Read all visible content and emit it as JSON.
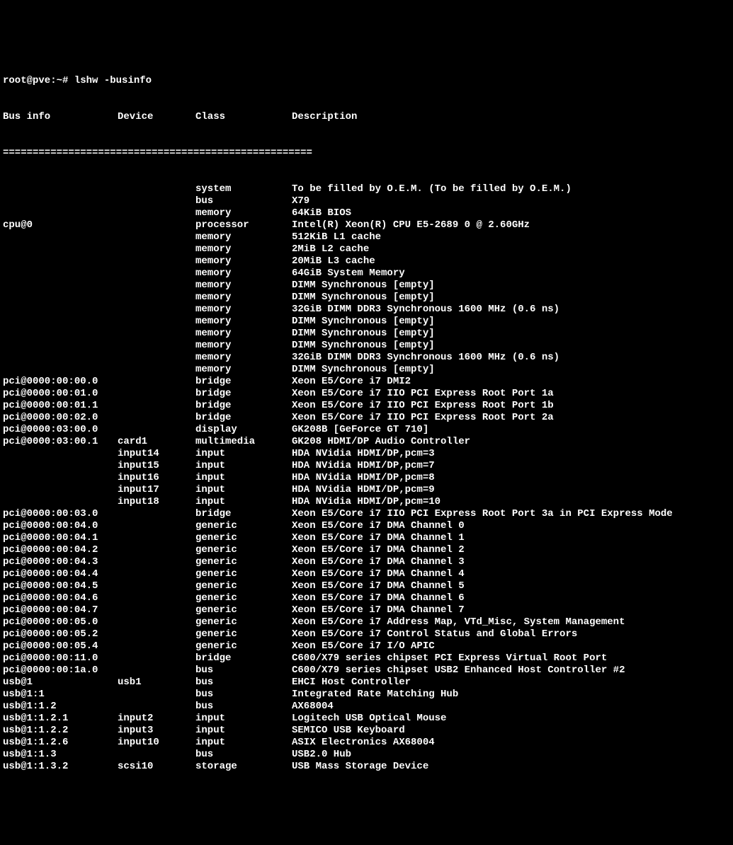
{
  "prompt": "root@pve:~# ",
  "command": "lshw -businfo",
  "header": {
    "bus": "Bus info",
    "device": "Device",
    "class": "Class",
    "description": "Description"
  },
  "separator": "====================================================",
  "rows": [
    {
      "bus": "",
      "dev": "",
      "class": "system",
      "desc": "To be filled by O.E.M. (To be filled by O.E.M.)"
    },
    {
      "bus": "",
      "dev": "",
      "class": "bus",
      "desc": "X79"
    },
    {
      "bus": "",
      "dev": "",
      "class": "memory",
      "desc": "64KiB BIOS"
    },
    {
      "bus": "cpu@0",
      "dev": "",
      "class": "processor",
      "desc": "Intel(R) Xeon(R) CPU E5-2689 0 @ 2.60GHz"
    },
    {
      "bus": "",
      "dev": "",
      "class": "memory",
      "desc": "512KiB L1 cache"
    },
    {
      "bus": "",
      "dev": "",
      "class": "memory",
      "desc": "2MiB L2 cache"
    },
    {
      "bus": "",
      "dev": "",
      "class": "memory",
      "desc": "20MiB L3 cache"
    },
    {
      "bus": "",
      "dev": "",
      "class": "memory",
      "desc": "64GiB System Memory"
    },
    {
      "bus": "",
      "dev": "",
      "class": "memory",
      "desc": "DIMM Synchronous [empty]"
    },
    {
      "bus": "",
      "dev": "",
      "class": "memory",
      "desc": "DIMM Synchronous [empty]"
    },
    {
      "bus": "",
      "dev": "",
      "class": "memory",
      "desc": "32GiB DIMM DDR3 Synchronous 1600 MHz (0.6 ns)"
    },
    {
      "bus": "",
      "dev": "",
      "class": "memory",
      "desc": "DIMM Synchronous [empty]"
    },
    {
      "bus": "",
      "dev": "",
      "class": "memory",
      "desc": "DIMM Synchronous [empty]"
    },
    {
      "bus": "",
      "dev": "",
      "class": "memory",
      "desc": "DIMM Synchronous [empty]"
    },
    {
      "bus": "",
      "dev": "",
      "class": "memory",
      "desc": "32GiB DIMM DDR3 Synchronous 1600 MHz (0.6 ns)"
    },
    {
      "bus": "",
      "dev": "",
      "class": "memory",
      "desc": "DIMM Synchronous [empty]"
    },
    {
      "bus": "pci@0000:00:00.0",
      "dev": "",
      "class": "bridge",
      "desc": "Xeon E5/Core i7 DMI2"
    },
    {
      "bus": "pci@0000:00:01.0",
      "dev": "",
      "class": "bridge",
      "desc": "Xeon E5/Core i7 IIO PCI Express Root Port 1a"
    },
    {
      "bus": "pci@0000:00:01.1",
      "dev": "",
      "class": "bridge",
      "desc": "Xeon E5/Core i7 IIO PCI Express Root Port 1b"
    },
    {
      "bus": "pci@0000:00:02.0",
      "dev": "",
      "class": "bridge",
      "desc": "Xeon E5/Core i7 IIO PCI Express Root Port 2a"
    },
    {
      "bus": "pci@0000:03:00.0",
      "dev": "",
      "class": "display",
      "desc": "GK208B [GeForce GT 710]"
    },
    {
      "bus": "pci@0000:03:00.1",
      "dev": "card1",
      "class": "multimedia",
      "desc": "GK208 HDMI/DP Audio Controller"
    },
    {
      "bus": "",
      "dev": "input14",
      "class": "input",
      "desc": "HDA NVidia HDMI/DP,pcm=3"
    },
    {
      "bus": "",
      "dev": "input15",
      "class": "input",
      "desc": "HDA NVidia HDMI/DP,pcm=7"
    },
    {
      "bus": "",
      "dev": "input16",
      "class": "input",
      "desc": "HDA NVidia HDMI/DP,pcm=8"
    },
    {
      "bus": "",
      "dev": "input17",
      "class": "input",
      "desc": "HDA NVidia HDMI/DP,pcm=9"
    },
    {
      "bus": "",
      "dev": "input18",
      "class": "input",
      "desc": "HDA NVidia HDMI/DP,pcm=10"
    },
    {
      "bus": "pci@0000:00:03.0",
      "dev": "",
      "class": "bridge",
      "desc": "Xeon E5/Core i7 IIO PCI Express Root Port 3a in PCI Express Mode"
    },
    {
      "bus": "pci@0000:00:04.0",
      "dev": "",
      "class": "generic",
      "desc": "Xeon E5/Core i7 DMA Channel 0"
    },
    {
      "bus": "pci@0000:00:04.1",
      "dev": "",
      "class": "generic",
      "desc": "Xeon E5/Core i7 DMA Channel 1"
    },
    {
      "bus": "pci@0000:00:04.2",
      "dev": "",
      "class": "generic",
      "desc": "Xeon E5/Core i7 DMA Channel 2"
    },
    {
      "bus": "pci@0000:00:04.3",
      "dev": "",
      "class": "generic",
      "desc": "Xeon E5/Core i7 DMA Channel 3"
    },
    {
      "bus": "pci@0000:00:04.4",
      "dev": "",
      "class": "generic",
      "desc": "Xeon E5/Core i7 DMA Channel 4"
    },
    {
      "bus": "pci@0000:00:04.5",
      "dev": "",
      "class": "generic",
      "desc": "Xeon E5/Core i7 DMA Channel 5"
    },
    {
      "bus": "pci@0000:00:04.6",
      "dev": "",
      "class": "generic",
      "desc": "Xeon E5/Core i7 DMA Channel 6"
    },
    {
      "bus": "pci@0000:00:04.7",
      "dev": "",
      "class": "generic",
      "desc": "Xeon E5/Core i7 DMA Channel 7"
    },
    {
      "bus": "pci@0000:00:05.0",
      "dev": "",
      "class": "generic",
      "desc": "Xeon E5/Core i7 Address Map, VTd_Misc, System Management"
    },
    {
      "bus": "pci@0000:00:05.2",
      "dev": "",
      "class": "generic",
      "desc": "Xeon E5/Core i7 Control Status and Global Errors"
    },
    {
      "bus": "pci@0000:00:05.4",
      "dev": "",
      "class": "generic",
      "desc": "Xeon E5/Core i7 I/O APIC"
    },
    {
      "bus": "pci@0000:00:11.0",
      "dev": "",
      "class": "bridge",
      "desc": "C600/X79 series chipset PCI Express Virtual Root Port"
    },
    {
      "bus": "pci@0000:00:1a.0",
      "dev": "",
      "class": "bus",
      "desc": "C600/X79 series chipset USB2 Enhanced Host Controller #2"
    },
    {
      "bus": "usb@1",
      "dev": "usb1",
      "class": "bus",
      "desc": "EHCI Host Controller"
    },
    {
      "bus": "usb@1:1",
      "dev": "",
      "class": "bus",
      "desc": "Integrated Rate Matching Hub"
    },
    {
      "bus": "usb@1:1.2",
      "dev": "",
      "class": "bus",
      "desc": "AX68004"
    },
    {
      "bus": "usb@1:1.2.1",
      "dev": "input2",
      "class": "input",
      "desc": "Logitech USB Optical Mouse"
    },
    {
      "bus": "usb@1:1.2.2",
      "dev": "input3",
      "class": "input",
      "desc": "SEMICO USB Keyboard"
    },
    {
      "bus": "usb@1:1.2.6",
      "dev": "input10",
      "class": "input",
      "desc": "ASIX Electronics AX68004"
    },
    {
      "bus": "usb@1:1.3",
      "dev": "",
      "class": "bus",
      "desc": "USB2.0 Hub"
    },
    {
      "bus": "usb@1:1.3.2",
      "dev": "scsi10",
      "class": "storage",
      "desc": "USB Mass Storage Device"
    }
  ]
}
